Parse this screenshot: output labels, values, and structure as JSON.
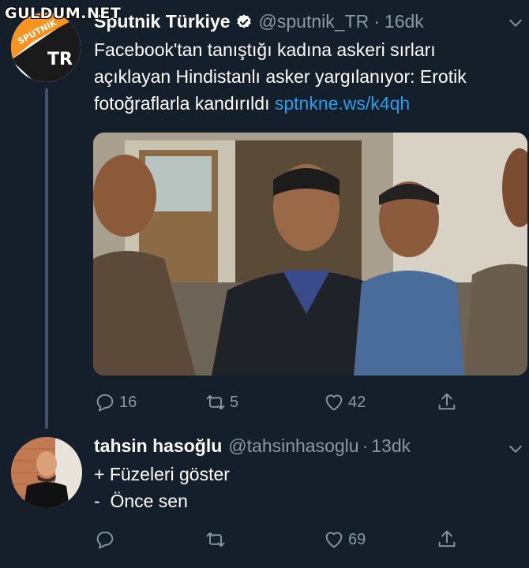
{
  "watermark": "GULDUM.NET",
  "tweets": [
    {
      "display_name": "Sputnik Türkiye",
      "handle": "@sputnik_TR",
      "separator": "·",
      "time": "16dk",
      "avatar_text_top": "SPUTNIK",
      "avatar_text_bottom": "TR",
      "text_lines": [
        "Facebook'tan tanıştığı kadına askeri sırları",
        "açıklayan Hindistanlı asker yargılanıyor: Erotik",
        "fotoğraflarla kandırıldı"
      ],
      "link": "sptnkne.ws/k4qh",
      "replies": "16",
      "retweets": "5",
      "likes": "42",
      "verified": true
    },
    {
      "display_name": "tahsin hasoğlu",
      "handle": "@tahsinhasoglu",
      "separator": "·",
      "time": "13dk",
      "text_lines": [
        "+ Füzeleri göster",
        "-  Önce sen"
      ],
      "replies": "",
      "retweets": "",
      "likes": "69"
    }
  ],
  "colors": {
    "background": "#151f2b",
    "text": "#ffffff",
    "secondary": "#8899a6",
    "link": "#1da1f2",
    "brand_orange": "#f7931e"
  },
  "icons": [
    "reply-icon",
    "retweet-icon",
    "like-icon",
    "share-icon",
    "verified-badge-icon",
    "caret-down-icon"
  ]
}
